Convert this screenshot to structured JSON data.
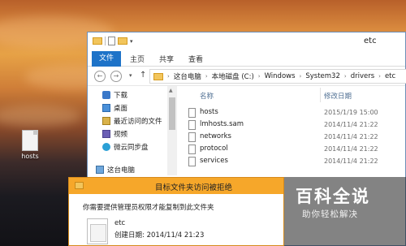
{
  "desktop": {
    "icon_label": "hosts"
  },
  "window": {
    "title": "etc",
    "ribbon_tabs": [
      "文件",
      "主页",
      "共享",
      "查看"
    ],
    "breadcrumb": [
      "这台电脑",
      "本地磁盘 (C:)",
      "Windows",
      "System32",
      "drivers",
      "etc"
    ],
    "nav_items": [
      {
        "label": "下载",
        "icon": "download-icon"
      },
      {
        "label": "桌面",
        "icon": "desktop-icon"
      },
      {
        "label": "最近访问的文件",
        "icon": "recent-icon"
      },
      {
        "label": "视频",
        "icon": "video-icon"
      },
      {
        "label": "微云同步盘",
        "icon": "cloud-sync-icon"
      },
      {
        "label": "这台电脑",
        "icon": "this-pc-icon"
      }
    ],
    "columns": {
      "name": "名称",
      "date": "修改日期"
    },
    "files": [
      {
        "name": "hosts",
        "date": "2015/1/19 15:00"
      },
      {
        "name": "lmhosts.sam",
        "date": "2014/11/4 21:22"
      },
      {
        "name": "networks",
        "date": "2014/11/4 21:22"
      },
      {
        "name": "protocol",
        "date": "2014/11/4 21:22"
      },
      {
        "name": "services",
        "date": "2014/11/4 21:22"
      }
    ]
  },
  "dialog": {
    "title": "目标文件夹访问被拒绝",
    "message": "你需要提供管理员权限才能复制到此文件夹",
    "folder_name": "etc",
    "created": "创建日期: 2014/11/4 21:23"
  },
  "watermark": {
    "main": "百科全说",
    "sub": "助你轻松解决"
  }
}
